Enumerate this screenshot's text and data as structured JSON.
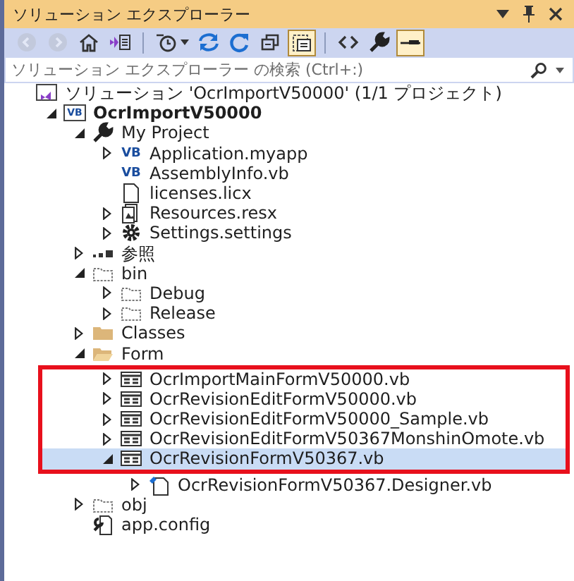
{
  "window": {
    "title": "ソリューション エクスプローラー"
  },
  "toolbar": [
    {
      "kind": "back",
      "disabled": true,
      "on": false
    },
    {
      "kind": "forward",
      "disabled": true,
      "on": false
    },
    {
      "kind": "home",
      "disabled": false,
      "on": false
    },
    {
      "kind": "switch-views",
      "disabled": false,
      "on": false
    },
    {
      "kind": "separator"
    },
    {
      "kind": "history",
      "disabled": false,
      "on": false,
      "dropdown": true
    },
    {
      "kind": "sync",
      "disabled": false,
      "on": false
    },
    {
      "kind": "refresh",
      "disabled": false,
      "on": false
    },
    {
      "kind": "collapse",
      "disabled": false,
      "on": false
    },
    {
      "kind": "show-all",
      "disabled": false,
      "on": true
    },
    {
      "kind": "separator"
    },
    {
      "kind": "code",
      "disabled": false,
      "on": false
    },
    {
      "kind": "properties",
      "disabled": false,
      "on": false
    },
    {
      "kind": "preview",
      "disabled": false,
      "on": true
    }
  ],
  "search": {
    "placeholder": "ソリューション エクスプローラー の検索 (Ctrl+:)"
  },
  "tree": [
    {
      "label": "ソリューション 'OcrImportV50000' (1/1 プロジェクト)",
      "kind": "solution",
      "selected": false,
      "children": [
        {
          "label": "OcrImportV50000",
          "kind": "vbproject",
          "badge": "VB",
          "bold": true,
          "expanded": true,
          "selected": false,
          "children": [
            {
              "label": "My Project",
              "kind": "wrench",
              "expanded": true,
              "selected": false,
              "children": [
                {
                  "label": "Application.myapp",
                  "kind": "vbfile",
                  "badge": "VB",
                  "expanded": false,
                  "selected": false
                },
                {
                  "label": "AssemblyInfo.vb",
                  "kind": "vbfile",
                  "badge": "VB",
                  "selected": false
                },
                {
                  "label": "licenses.licx",
                  "kind": "file",
                  "selected": false
                },
                {
                  "label": "Resources.resx",
                  "kind": "resx",
                  "expanded": false,
                  "selected": false
                },
                {
                  "label": "Settings.settings",
                  "kind": "gear",
                  "expanded": false,
                  "selected": false
                }
              ]
            },
            {
              "label": "参照",
              "kind": "references",
              "expanded": false,
              "selected": false
            },
            {
              "label": "bin",
              "kind": "folder-dashed",
              "expanded": true,
              "selected": false,
              "children": [
                {
                  "label": "Debug",
                  "kind": "folder-dashed",
                  "expanded": false,
                  "selected": false
                },
                {
                  "label": "Release",
                  "kind": "folder-dashed",
                  "expanded": false,
                  "selected": false
                }
              ]
            },
            {
              "label": "Classes",
              "kind": "folder",
              "expanded": false,
              "selected": false
            },
            {
              "label": "Form",
              "kind": "folder-open",
              "expanded": true,
              "selected": false,
              "children": [
                {
                  "label": "OcrImportMainFormV50000.vb",
                  "kind": "form",
                  "highlighted": true,
                  "expanded": false,
                  "selected": false
                },
                {
                  "label": "OcrRevisionEditFormV50000.vb",
                  "kind": "form",
                  "highlighted": true,
                  "expanded": false,
                  "selected": false
                },
                {
                  "label": "OcrRevisionEditFormV50000_Sample.vb",
                  "kind": "form",
                  "highlighted": true,
                  "expanded": false,
                  "selected": false
                },
                {
                  "label": "OcrRevisionEditFormV50367MonshinOmote.vb",
                  "kind": "form",
                  "highlighted": true,
                  "expanded": false,
                  "selected": false
                },
                {
                  "label": "OcrRevisionFormV50367.vb",
                  "kind": "form",
                  "highlighted": true,
                  "expanded": true,
                  "selected": true,
                  "children": [
                    {
                      "label": "OcrRevisionFormV50367.Designer.vb",
                      "kind": "designer",
                      "expanded": false,
                      "selected": false
                    }
                  ]
                }
              ]
            },
            {
              "label": "obj",
              "kind": "folder-dashed",
              "expanded": false,
              "selected": false
            },
            {
              "label": "app.config",
              "kind": "config",
              "selected": false
            }
          ]
        }
      ]
    }
  ]
}
